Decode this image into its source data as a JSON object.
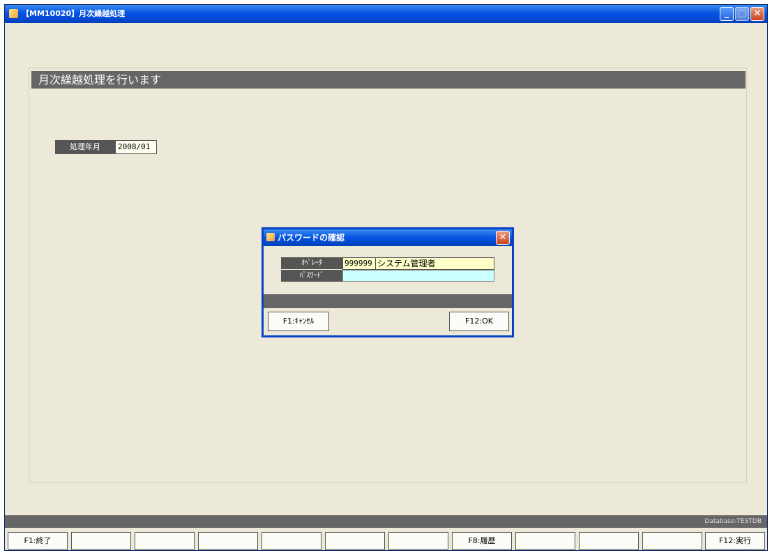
{
  "window": {
    "title": "【MM10020】月次繰越処理",
    "minimize": "_",
    "maximize": "□",
    "close": "✕"
  },
  "main": {
    "header": "月次繰越処理を行います",
    "date_label": "処理年月",
    "date_value": "2008/01"
  },
  "dialog": {
    "title": "パスワードの確認",
    "close": "✕",
    "operator_label": "ｵﾍﾟﾚｰﾀ",
    "operator_code": "999999",
    "operator_name": "システム管理者",
    "password_label": "ﾊﾟｽﾜｰﾄﾞ",
    "password_value": "",
    "cancel_button": "F1:ｷｬﾝｾﾙ",
    "ok_button": "F12:OK"
  },
  "status": {
    "database": "Database:TESTDB"
  },
  "fkeys": [
    "F1:終了",
    "",
    "",
    "",
    "",
    "",
    "",
    "F8:履歴",
    "",
    "",
    "",
    "F12:実行"
  ]
}
